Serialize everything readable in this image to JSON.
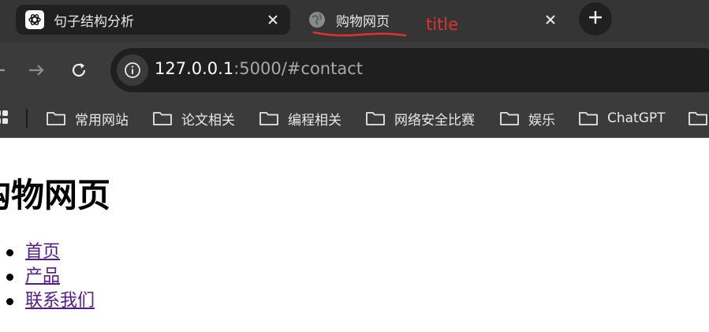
{
  "tabs": [
    {
      "title": "句子结构分析",
      "favicon": "chatgpt-icon",
      "active": false
    },
    {
      "title": "购物网页",
      "favicon": "globe-icon",
      "active": true
    }
  ],
  "annotation": {
    "text": "title",
    "color": "#e0322e"
  },
  "address_bar": {
    "host": "127.0.0.1",
    "rest": ":5000/#contact"
  },
  "bookmarks": [
    {
      "label": "常用网站"
    },
    {
      "label": "论文相关"
    },
    {
      "label": "编程相关"
    },
    {
      "label": "网络安全比赛"
    },
    {
      "label": "娱乐"
    },
    {
      "label": "ChatGPT"
    }
  ],
  "page": {
    "heading": "购物网页",
    "nav": [
      {
        "label": "首页"
      },
      {
        "label": "产品"
      },
      {
        "label": "联系我们"
      }
    ]
  },
  "colors": {
    "link_visited": "#551a8b",
    "chrome_bg": "#353535",
    "toolbar_bg": "#3b3b3b"
  }
}
